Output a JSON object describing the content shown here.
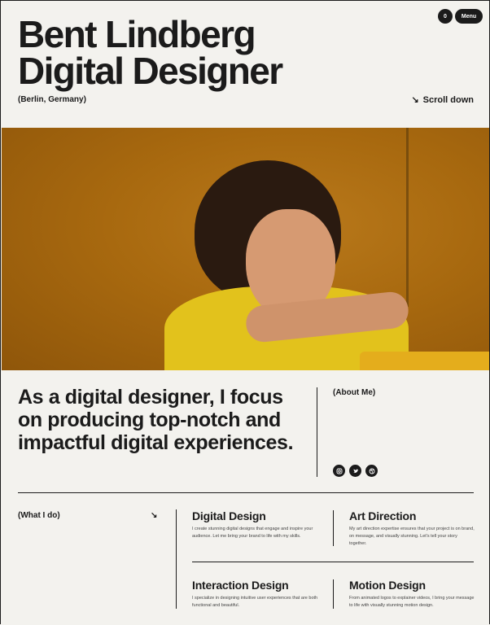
{
  "header": {
    "name": "Bent Lindberg",
    "role": "Digital Designer",
    "location": "(Berlin, Germany)",
    "scroll": "Scroll down",
    "scroll_arrow": "↘",
    "cart_count": "0",
    "menu": "Menu"
  },
  "intro": {
    "statement": "As a digital designer, I focus on producing top-notch and impactful digital experiences.",
    "about_label": "(About Me)",
    "socials": [
      "instagram-icon",
      "twitter-icon",
      "dribbble-icon"
    ]
  },
  "services": {
    "label": "(What I do)",
    "arrow": "↘",
    "items": [
      {
        "title": "Digital Design",
        "desc": "I create stunning digital designs that engage and inspire your audience. Let me bring your brand to life with my skills."
      },
      {
        "title": "Art Direction",
        "desc": "My art direction expertise ensures that your project is on brand, on message, and visually stunning. Let's tell your story together."
      },
      {
        "title": "Interaction Design",
        "desc": "I specialize in designing intuitive user experiences that are both functional and beautiful."
      },
      {
        "title": "Motion Design",
        "desc": "From animated logos to explainer videos, I bring your message to life with visually stunning motion design."
      }
    ]
  },
  "colors": {
    "background": "#f3f2ee",
    "text": "#1b1b1b",
    "hero_orange": "#a8690f",
    "shirt_yellow": "#e2c21c"
  }
}
